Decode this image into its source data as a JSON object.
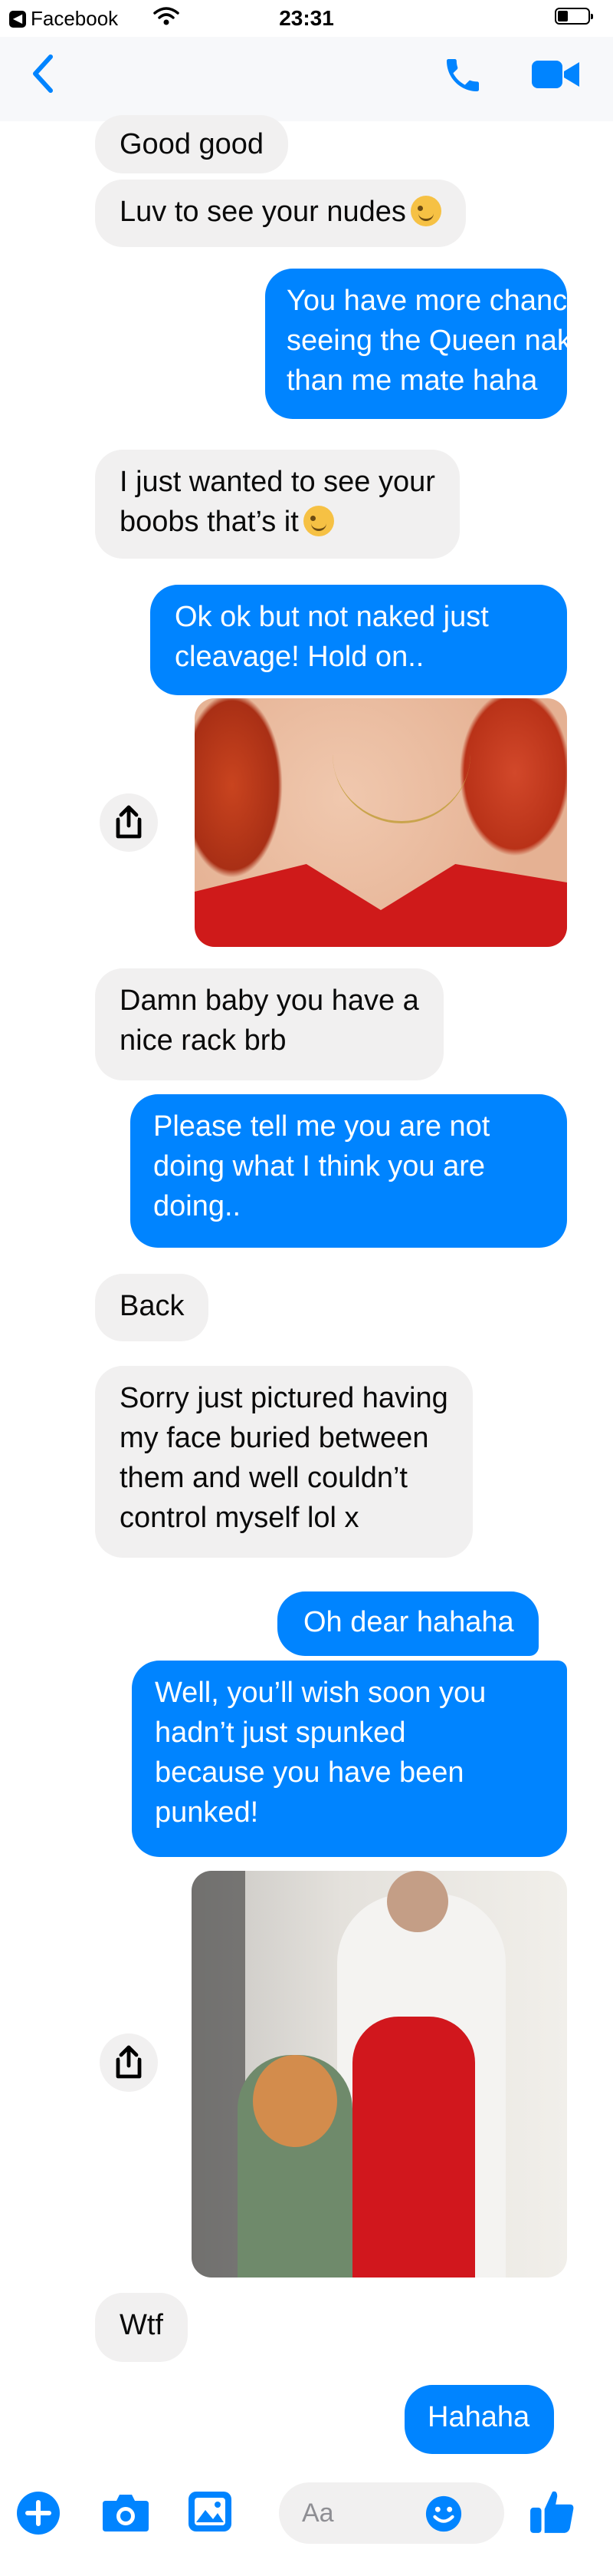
{
  "status_bar": {
    "back_app_label": "Facebook",
    "time": "23:31"
  },
  "nav": {
    "back_icon": "chevron-left-icon",
    "call_icon": "phone-icon",
    "video_icon": "video-camera-icon"
  },
  "messages": [
    {
      "side": "in",
      "text": "Good good"
    },
    {
      "side": "in",
      "text": "Luv to see your nudes",
      "emoji": "winking-face"
    },
    {
      "side": "out",
      "lines": [
        "You have more chance of",
        "seeing the Queen naked",
        "than me mate haha"
      ]
    },
    {
      "side": "in",
      "lines": [
        "I just wanted to see your",
        "boobs that’s it"
      ],
      "emoji": "winking-face"
    },
    {
      "side": "out",
      "lines": [
        "Ok ok but not naked just",
        "cleavage! Hold on.."
      ]
    },
    {
      "side": "in",
      "lines": [
        "Damn baby you have a",
        "nice rack brb"
      ]
    },
    {
      "side": "out",
      "lines": [
        "Please tell me you are not",
        "doing what I think you are",
        "doing.."
      ]
    },
    {
      "side": "in",
      "text": "Back"
    },
    {
      "side": "in",
      "lines": [
        "Sorry just pictured having",
        "my face buried between",
        "them and well couldn’t",
        "control myself lol x"
      ]
    },
    {
      "side": "out",
      "text": "Oh dear hahaha"
    },
    {
      "side": "out",
      "lines": [
        "Well, you’ll wish soon you",
        "hadn’t just spunked",
        "because you have been",
        "punked!"
      ]
    },
    {
      "side": "in",
      "text": "Wtf"
    },
    {
      "side": "out",
      "text": "Hahaha"
    }
  ],
  "composer": {
    "placeholder": "Aa",
    "icons": [
      "plus-icon",
      "camera-icon",
      "gallery-icon",
      "emoji-icon",
      "thumbs-up-icon"
    ]
  },
  "colors": {
    "accent": "#0084ff",
    "incoming_bubble": "#f1f0f0",
    "outgoing_text": "#ffffff"
  }
}
